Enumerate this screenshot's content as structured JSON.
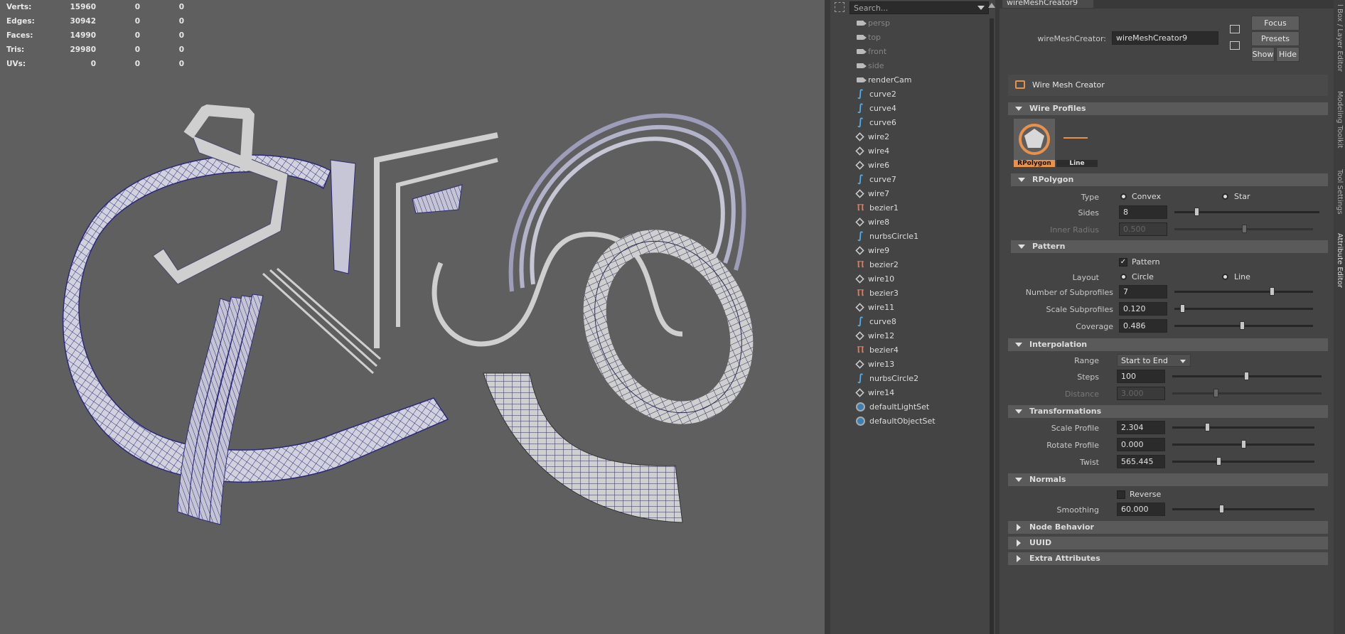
{
  "hud": {
    "rows": [
      {
        "label": "Verts:",
        "a": "15960",
        "b": "0",
        "c": "0"
      },
      {
        "label": "Edges:",
        "a": "30942",
        "b": "0",
        "c": "0"
      },
      {
        "label": "Faces:",
        "a": "14990",
        "b": "0",
        "c": "0"
      },
      {
        "label": "Tris:",
        "a": "29980",
        "b": "0",
        "c": "0"
      },
      {
        "label": "UVs:",
        "a": "0",
        "b": "0",
        "c": "0"
      }
    ]
  },
  "outliner": {
    "search_placeholder": "Search...",
    "items": [
      {
        "label": "persp",
        "icon": "camera-icon",
        "dim": true
      },
      {
        "label": "top",
        "icon": "camera-icon",
        "dim": true
      },
      {
        "label": "front",
        "icon": "camera-icon",
        "dim": true
      },
      {
        "label": "side",
        "icon": "camera-icon",
        "dim": true
      },
      {
        "label": "renderCam",
        "icon": "camera-icon",
        "dim": false
      },
      {
        "label": "curve2",
        "icon": "curve-icon",
        "dim": false
      },
      {
        "label": "curve4",
        "icon": "curve-icon",
        "dim": false
      },
      {
        "label": "curve6",
        "icon": "curve-icon",
        "dim": false
      },
      {
        "label": "wire2",
        "icon": "mesh-icon",
        "dim": false
      },
      {
        "label": "wire4",
        "icon": "mesh-icon",
        "dim": false
      },
      {
        "label": "wire6",
        "icon": "mesh-icon",
        "dim": false
      },
      {
        "label": "curve7",
        "icon": "curve-icon",
        "dim": false
      },
      {
        "label": "wire7",
        "icon": "mesh-icon",
        "dim": false
      },
      {
        "label": "bezier1",
        "icon": "bezier-icon",
        "dim": false
      },
      {
        "label": "wire8",
        "icon": "mesh-icon",
        "dim": false
      },
      {
        "label": "nurbsCircle1",
        "icon": "curve-icon",
        "dim": false
      },
      {
        "label": "wire9",
        "icon": "mesh-icon",
        "dim": false
      },
      {
        "label": "bezier2",
        "icon": "bezier-icon",
        "dim": false
      },
      {
        "label": "wire10",
        "icon": "mesh-icon",
        "dim": false
      },
      {
        "label": "bezier3",
        "icon": "bezier-icon",
        "dim": false
      },
      {
        "label": "wire11",
        "icon": "mesh-icon",
        "dim": false
      },
      {
        "label": "curve8",
        "icon": "curve-icon",
        "dim": false
      },
      {
        "label": "wire12",
        "icon": "mesh-icon",
        "dim": false
      },
      {
        "label": "bezier4",
        "icon": "bezier-icon",
        "dim": false
      },
      {
        "label": "wire13",
        "icon": "mesh-icon",
        "dim": false
      },
      {
        "label": "nurbsCircle2",
        "icon": "curve-icon",
        "dim": false
      },
      {
        "label": "wire14",
        "icon": "mesh-icon",
        "dim": false
      },
      {
        "label": "defaultLightSet",
        "icon": "set-icon",
        "dim": false
      },
      {
        "label": "defaultObjectSet",
        "icon": "set-icon",
        "dim": false
      }
    ]
  },
  "ae": {
    "tab": "wireMeshCreator9",
    "node_label": "wireMeshCreator:",
    "node_value": "wireMeshCreator9",
    "focus": "Focus",
    "presets": "Presets",
    "show": "Show",
    "hide": "Hide",
    "header": "Wire Mesh Creator",
    "wire_profiles": "Wire Profiles",
    "profile_rpolygon": "RPolygon",
    "profile_line": "Line",
    "rpolygon": "RPolygon",
    "type_label": "Type",
    "type_convex": "Convex",
    "type_star": "Star",
    "sides_label": "Sides",
    "sides_value": "8",
    "inner_radius_label": "Inner Radius",
    "inner_radius_value": "0.500",
    "pattern": "Pattern",
    "pattern_check": "Pattern",
    "layout_label": "Layout",
    "layout_circle": "Circle",
    "layout_line": "Line",
    "num_sub_label": "Number of Subprofiles",
    "num_sub_value": "7",
    "scale_sub_label": "Scale Subprofiles",
    "scale_sub_value": "0.120",
    "coverage_label": "Coverage",
    "coverage_value": "0.486",
    "interpolation": "Interpolation",
    "range_label": "Range",
    "range_value": "Start to End",
    "steps_label": "Steps",
    "steps_value": "100",
    "distance_label": "Distance",
    "distance_value": "3.000",
    "transformations": "Transformations",
    "scale_profile_label": "Scale Profile",
    "scale_profile_value": "2.304",
    "rotate_profile_label": "Rotate Profile",
    "rotate_profile_value": "0.000",
    "twist_label": "Twist",
    "twist_value": "565.445",
    "normals": "Normals",
    "reverse_label": "Reverse",
    "smoothing_label": "Smoothing",
    "smoothing_value": "60.000",
    "node_behavior": "Node Behavior",
    "uuid": "UUID",
    "extra_attributes": "Extra Attributes"
  },
  "side_tabs": {
    "channel_box": "l Box / Layer Editor",
    "modeling_toolkit": "Modeling Toolkit",
    "tool_settings": "Tool Settings",
    "attribute_editor": "Attribute Editor"
  },
  "colors": {
    "viewport_bg": "#5f5f5f",
    "mesh_fill": "#c9c9d6",
    "wire_color": "#2b2a78",
    "profile_active": "#e8914a",
    "curve_icon": "#56aee8"
  }
}
